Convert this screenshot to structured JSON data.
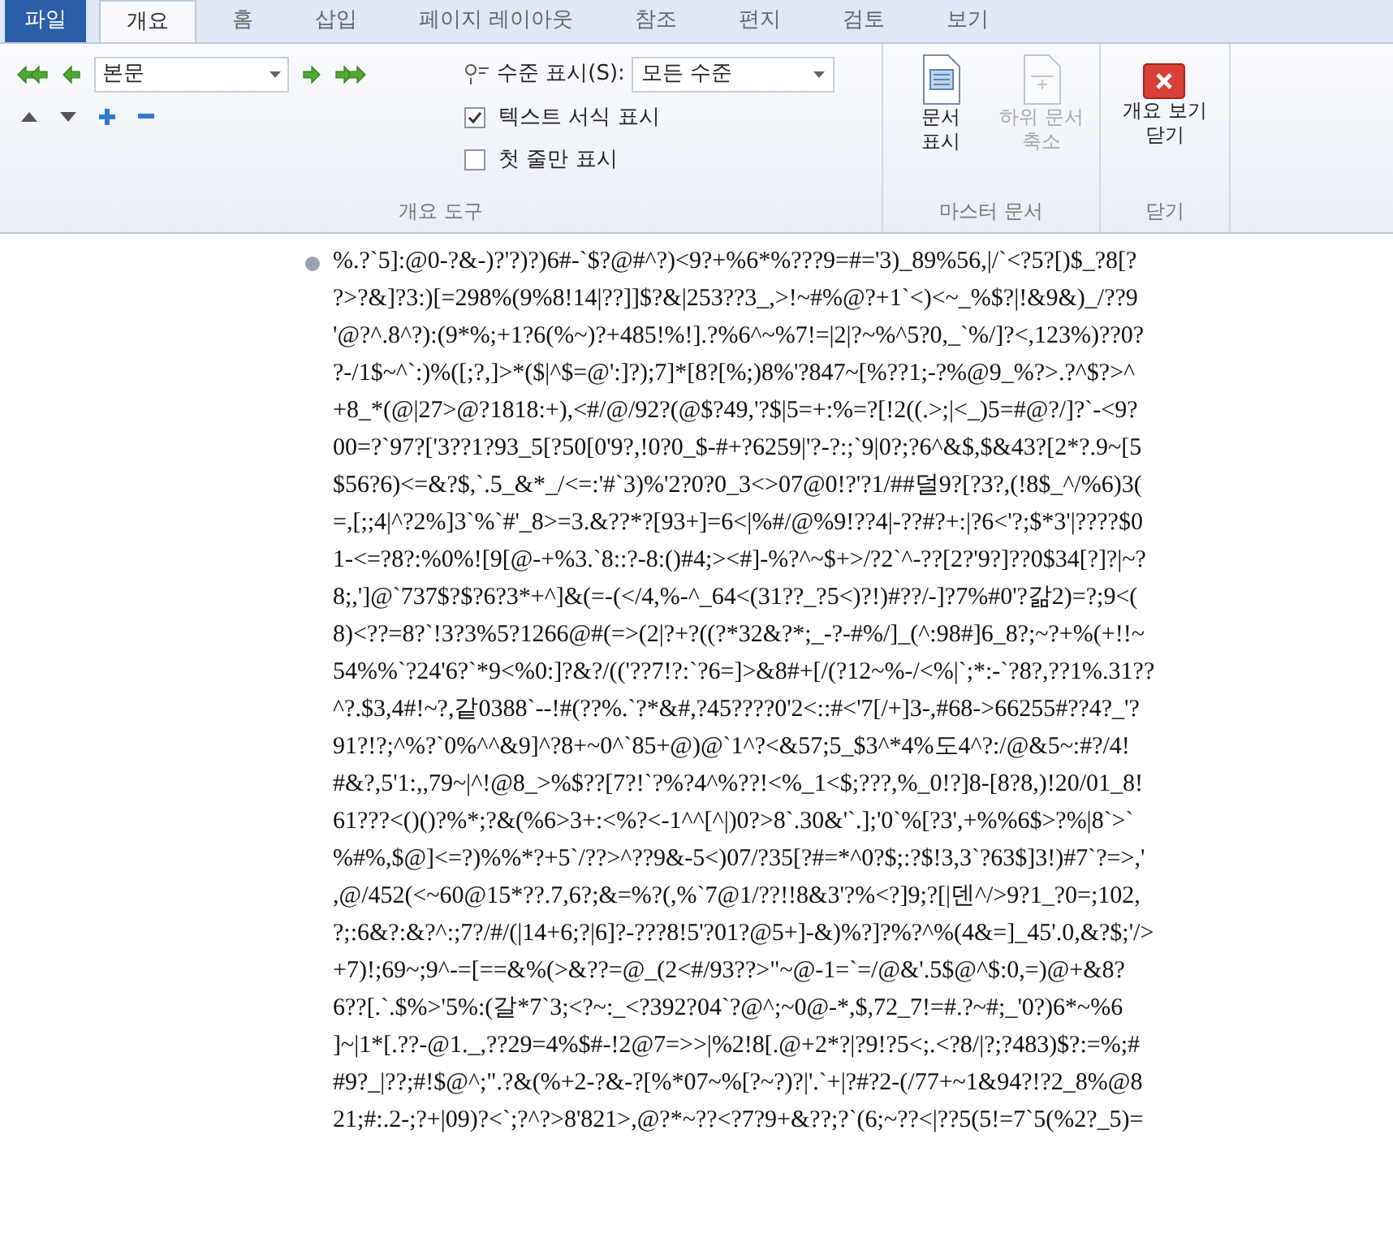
{
  "tabs": [
    {
      "label": "파일",
      "kind": "file",
      "selected": false
    },
    {
      "label": "개요",
      "kind": "tab",
      "selected": true
    },
    {
      "label": "홈",
      "kind": "tab",
      "selected": false
    },
    {
      "label": "삽입",
      "kind": "tab",
      "selected": false
    },
    {
      "label": "페이지 레이아웃",
      "kind": "tab",
      "selected": false
    },
    {
      "label": "참조",
      "kind": "tab",
      "selected": false
    },
    {
      "label": "편지",
      "kind": "tab",
      "selected": false
    },
    {
      "label": "검토",
      "kind": "tab",
      "selected": false
    },
    {
      "label": "보기",
      "kind": "tab",
      "selected": false
    }
  ],
  "outline_tools": {
    "level_dropdown": {
      "value": "본문"
    },
    "show_level": {
      "label": "수준 표시(S):",
      "value": "모든 수준"
    },
    "checkboxes": [
      {
        "label": "텍스트 서식 표시",
        "checked": true
      },
      {
        "label": "첫 줄만 표시",
        "checked": false
      }
    ],
    "group_label": "개요 도구"
  },
  "master_document": {
    "buttons": [
      {
        "lines": [
          "문서",
          "표시"
        ],
        "disabled": false
      },
      {
        "lines": [
          "하위 문서",
          "축소"
        ],
        "disabled": true
      }
    ],
    "group_label": "마스터 문서"
  },
  "close": {
    "button": {
      "lines": [
        "개요 보기",
        "닫기"
      ]
    },
    "group_label": "닫기"
  },
  "document": {
    "paragraphs": [
      {
        "lines": [
          "%.?`5]:@0-?&-)?'?)?)6#-`$?@#^?)<9?+%6*%???9=#='3)_89%56,|/`<?5?[)$_?8[?",
          "?>?&]?3:)[=298%(9%8!14|??]]$?&|253??3_,>!~#%@?+1`<)<~_%$?|!&9&)_/??9",
          "'@?^.8^?):(9*%;+1?6(%~)?+485!%!].?%6^~%7!=|2|?~%^5?0,_`%/]?<,123%)??0?",
          "?-/1$~^`:)%([;?,]>*($|^$=@':]?);7]*[8?[%;)8%'?847~[%??1;-?%@9_%?>.?^$?>^",
          "+8_*(@|27>@?1818:+),<#/@/92?(@$?49,'?$|5=+:%=?[!2((.>;|<_)5=#@?/]?`-<9?",
          "00=?`97?['3??1?93_5[?50[0'9?,!0?0_$-#+?6259|'?-?:;`9|0?;?6^&$,$&43?[2*?.9~[5",
          "$56?6)<=&?$,`.5_&*_/<=:'#`3)%'2?0?0_3<>07@0!?'?1/##덜9?[?3?,(!8$_^/%6)3(",
          "=,[;;4|^?2%]3`%`#'_8>=3.&??*?[93+]=6<|%#/@%9!??4|-??#?+:|?6<'?;$*3'|????$0",
          "1-<=?8?:%0%![9[@-+%3.`8::?-8:()#4;><#]-%?^~$+>/?2`^-??[2?'9?]??0$34[?]?|~?",
          "8;,']@`737$?$?6?3*+^]&(=-(</4,%-^_64<(31??_?5<)?!)#??/-]?7%#0'?갊2)=?;9<(",
          "8)<??=8?`!3?3%5?1266@#(=>(2|?+?((?*32&?*;_-?-#%/]_(^:98#]6_8?;~?+%(+!!~",
          "54%%`?24'6?`*9<%0:]?&?/(('??7!?:`?6=]>&8#+[/(?12~%-/<%|`;*:-`?8?,??1%.31??",
          "^?.$3,4#!~?,같0388`--!#(??%.`?*&#,?45????0'2<::#<'7[/+]3-,#68->66255#??4?_'?",
          "91?!?;^%?`0%^^&9]^?8+~0^`85+@)@`1^?<&57;5_$3^*4%도4^?:/@&5~:#?/4!",
          "#&?,5'1:,,79~|^!@8_>%$??[7?!`?%?4^%??!<%_1<$;???,%_0!?]8-[8?8,)!20/01_8!",
          "61???<()()?%*;?&(%6>3+:<%?<-1^^[^|)0?>8`.30&'`.];'0`%[?3',+%%6$>?%|8`>`",
          "%#%,$@]<=?)%%*?+5`/??>^??9&-5<)07/?35[?#=*^0?$;:?$!3,3`?63$]3!)#7`?=>,'",
          ",@/452(<~60@15*??.7,6?;&=%?(,%`7@1/??!!8&3'?%<?]9;?[|덴^/>9?1_?0=;102,",
          "?;:6&?:&?^:;7?/#/(|14+6;?|6]?-???8!5'?01?@5+]-&)%?]?%?^%(4&=]_45'.0,&?$;'/>",
          "+7)!;69~;9^-=[==&%(>&??=@_(2<#/93??>\"~@-1=`=/@&'.5$@^$:0,=)@+&8?",
          "6??[.`.$%>'5%:(갈*7`3;<?~:_<?392?04`?@^;~0@-*,$,72_7!=#.?~#;_'0?)6*~%6",
          "]~|1*[.??-@1._,??29=4%$#-!2@7=>>|%2!8[.@+2*?|?9!?5<;.<?8/|?;?483)$?:=%;#",
          "#9?_|??;#!$@^;\".?&(%+2-?&-?[%*07~%[?~?)?|'.`+|?#?2-(/77+~1&94?!?2_8%@8",
          "21;#:.2-;?+|09)?<`;?^?>8'821>,@?*~??<?7?9+&??;?`(6;~??<|??5(5!=7`5(%2?_5)="
        ]
      }
    ]
  }
}
